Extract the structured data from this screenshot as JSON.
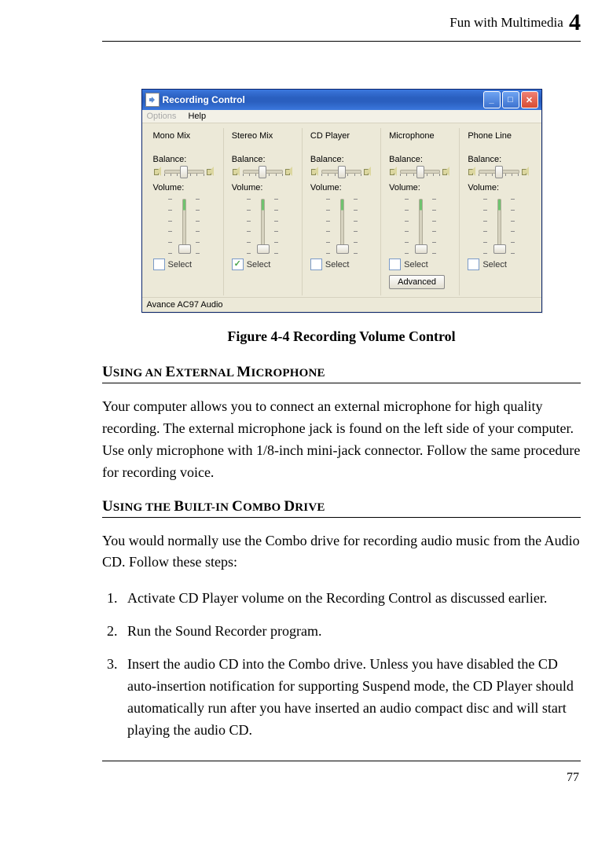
{
  "header": {
    "title": "Fun with Multimedia",
    "chapter": "4"
  },
  "figure": {
    "window_title": "Recording Control",
    "menu": {
      "options": "Options",
      "help": "Help"
    },
    "channels": [
      {
        "name": "Mono Mix",
        "balance": "Balance:",
        "volume": "Volume:",
        "select": "Select",
        "checked": false,
        "advanced": false
      },
      {
        "name": "Stereo Mix",
        "balance": "Balance:",
        "volume": "Volume:",
        "select": "Select",
        "checked": true,
        "advanced": false
      },
      {
        "name": "CD Player",
        "balance": "Balance:",
        "volume": "Volume:",
        "select": "Select",
        "checked": false,
        "advanced": false
      },
      {
        "name": "Microphone",
        "balance": "Balance:",
        "volume": "Volume:",
        "select": "Select",
        "checked": false,
        "advanced": true,
        "advanced_label": "Advanced"
      },
      {
        "name": "Phone Line",
        "balance": "Balance:",
        "volume": "Volume:",
        "select": "Select",
        "checked": false,
        "advanced": false
      }
    ],
    "status": "Avance AC97 Audio",
    "caption": "Figure 4-4 Recording Volume Control"
  },
  "sections": {
    "ext_mic": {
      "heading_parts": [
        "U",
        "SING AN ",
        "E",
        "XTERNAL ",
        "M",
        "ICROPHONE"
      ],
      "body": "Your computer allows you to connect an external microphone for high quality recording. The external microphone jack is found on the left side of your computer. Use only microphone with 1/8-inch mini-jack connector. Follow the same procedure for recording voice."
    },
    "combo": {
      "heading_parts": [
        "U",
        "SING THE ",
        "B",
        "UILT",
        "-",
        "IN ",
        "C",
        "OMBO ",
        "D",
        "RIVE"
      ],
      "intro": "You would normally use the Combo drive for recording audio music from the Audio CD. Follow these steps:",
      "steps": [
        "Activate CD Player volume on the Recording Control as discussed earlier.",
        "Run the Sound Recorder program.",
        "Insert the audio CD into the Combo drive. Unless you have disabled the CD auto-insertion notification for supporting Suspend mode, the CD Player should automatically run after you have inserted an audio compact disc and will start playing the audio CD."
      ]
    }
  },
  "page_number": "77"
}
